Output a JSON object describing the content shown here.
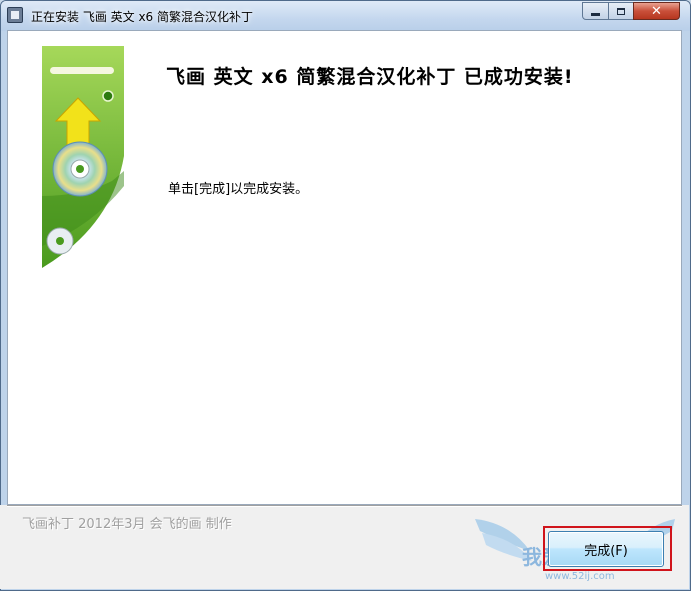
{
  "window": {
    "title": "正在安装 飞画 英文 x6 简繁混合汉化补丁",
    "close_glyph": "✕",
    "app_icon": "installer-icon"
  },
  "main": {
    "heading": "飞画 英文 x6 简繁混合汉化补丁 已成功安装!",
    "message": "单击[完成]以完成安装。",
    "side_image": "installer-cd-graphic"
  },
  "footer": {
    "credit_text": "飞画补丁   2012年3月 会飞的画 制作",
    "finish_label": "完成(F)",
    "watermark_text": "我爱IT技术网",
    "watermark_url": "www.52ij.com"
  },
  "colors": {
    "accent_green": "#8cc63f",
    "highlight_red": "#d0141b",
    "close_red": "#c9503a"
  }
}
